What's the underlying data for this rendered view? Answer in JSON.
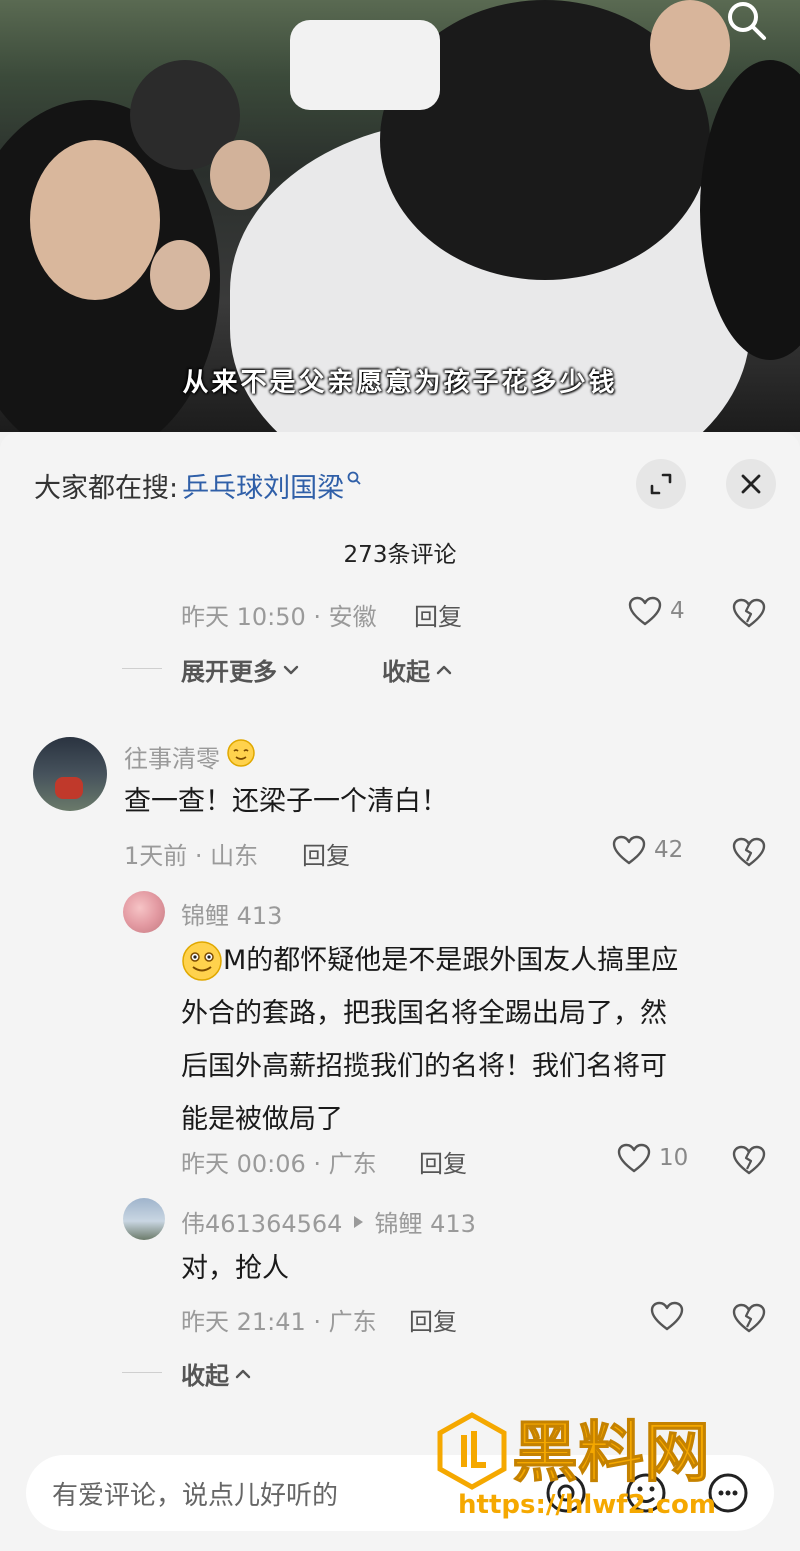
{
  "video": {
    "subtitle": "从来不是父亲愿意为孩子花多少钱",
    "search_icon": "search-icon"
  },
  "sheet": {
    "hot_search_prefix": "大家都在搜:",
    "hot_search_keyword": "乒乓球刘国梁",
    "comment_count": "273条评论"
  },
  "reply_prev": {
    "meta": "昨天 10:50 · 安徽",
    "reply": "回复",
    "likes": "4"
  },
  "fold_prev": {
    "expand": "展开更多",
    "collapse": "收起"
  },
  "comment_main": {
    "username": "往事清零",
    "text": "查一查！还梁子一个清白！",
    "meta": "1天前 · 山东",
    "reply": "回复",
    "likes": "42"
  },
  "reply_1": {
    "username": "锦鲤 413",
    "lines": [
      "M的都怀疑他是不是跟外国友人搞里应",
      "外合的套路，把我国名将全踢出局了，然",
      "后国外高薪招揽我们的名将！我们名将可",
      "能是被做局了"
    ],
    "meta": "昨天 00:06 · 广东",
    "reply": "回复",
    "likes": "10"
  },
  "reply_2": {
    "username": "伟461364564",
    "reply_to": "锦鲤 413",
    "text": "对，抢人",
    "meta": "昨天 21:41 · 广东",
    "reply": "回复"
  },
  "fold_main": {
    "collapse": "收起"
  },
  "input": {
    "placeholder": "有爱评论，说点儿好听的"
  },
  "watermark": {
    "brand": "黑料网",
    "url": "https://hlwf2.com"
  },
  "colors": {
    "keyword": "#2f5fa8",
    "watermark": "#f5a800"
  }
}
